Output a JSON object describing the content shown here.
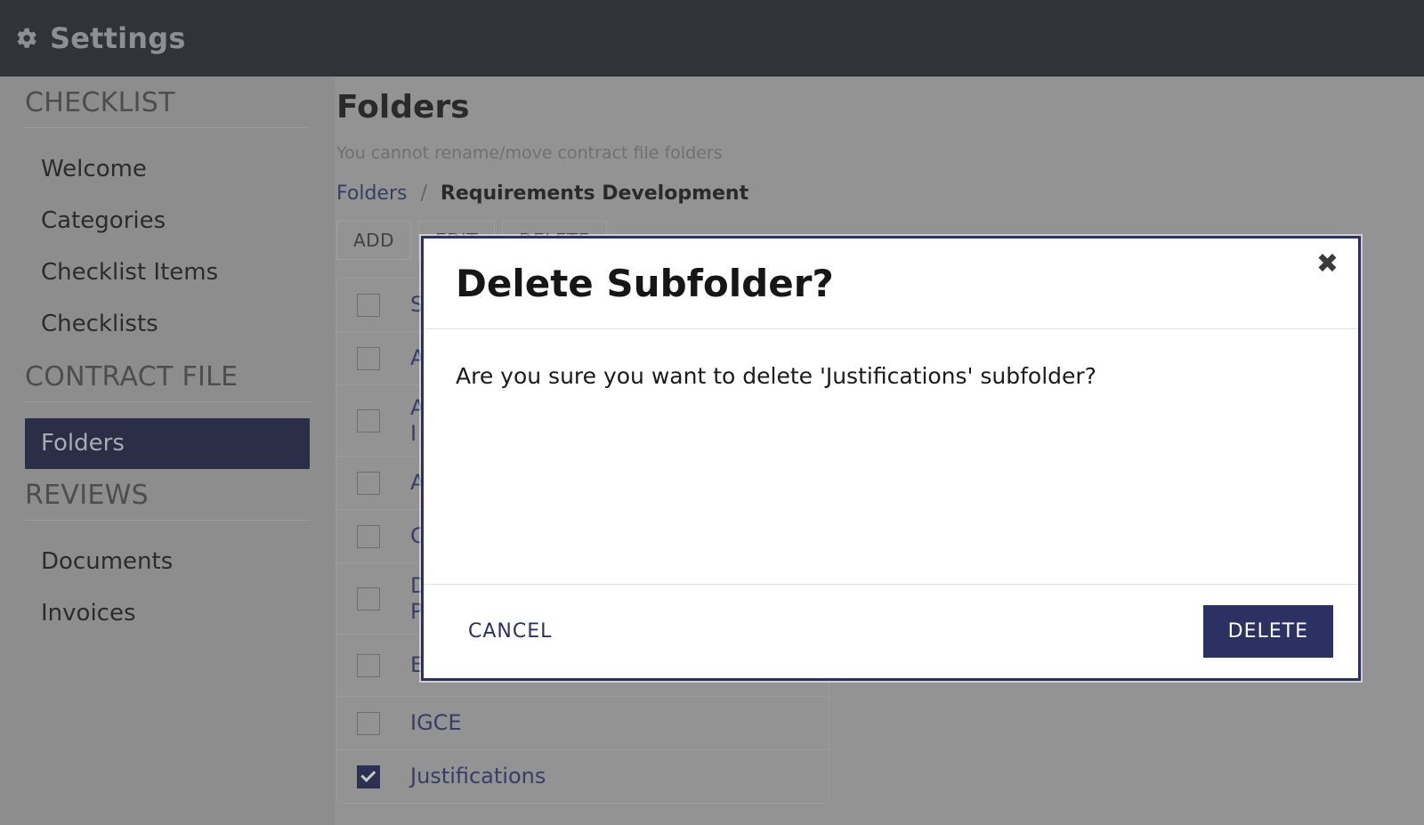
{
  "topbar": {
    "icon": "gear-icon",
    "title": "Settings"
  },
  "sidebar": {
    "sections": [
      {
        "heading": "CHECKLIST",
        "items": [
          {
            "label": "Welcome",
            "active": false
          },
          {
            "label": "Categories",
            "active": false
          },
          {
            "label": "Checklist Items",
            "active": false
          },
          {
            "label": "Checklists",
            "active": false
          }
        ]
      },
      {
        "heading": "CONTRACT FILE",
        "items": [
          {
            "label": "Folders",
            "active": true
          }
        ]
      },
      {
        "heading": "REVIEWS",
        "items": [
          {
            "label": "Documents",
            "active": false
          },
          {
            "label": "Invoices",
            "active": false
          }
        ]
      }
    ]
  },
  "main": {
    "page_title": "Folders",
    "subtitle": "You cannot rename/move contract file folders",
    "breadcrumb": {
      "root": "Folders",
      "separator": "/",
      "current": "Requirements Development"
    },
    "toolbar": {
      "add_label": "ADD",
      "edit_label": "EDIT",
      "delete_label": "DELETE"
    },
    "table": {
      "rows": [
        {
          "name": "S",
          "checked": false,
          "occluded": true
        },
        {
          "name": "A",
          "checked": false,
          "occluded": true
        },
        {
          "name": "A\nI",
          "checked": false,
          "occluded": true
        },
        {
          "name": "A",
          "checked": false,
          "occluded": true
        },
        {
          "name": "C",
          "checked": false,
          "occluded": true
        },
        {
          "name": "D\nP",
          "checked": false,
          "occluded": true
        },
        {
          "name": "E",
          "checked": false,
          "occluded": true
        },
        {
          "name": "IGCE",
          "checked": false,
          "occluded": false
        },
        {
          "name": "Justifications",
          "checked": true,
          "occluded": false
        }
      ]
    }
  },
  "modal": {
    "title": "Delete Subfolder?",
    "close_icon": "✖",
    "body_text": "Are you sure you want to delete 'Justifications' subfolder?",
    "cancel_label": "CANCEL",
    "delete_label": "DELETE"
  },
  "colors": {
    "topbar_bg": "#23282d",
    "page_bg": "#b0b0b0",
    "sidebar_bg": "#a8a8a8",
    "accent_navy": "#2b3163",
    "sidebar_active": "#1c2044",
    "link": "#2f3572"
  }
}
